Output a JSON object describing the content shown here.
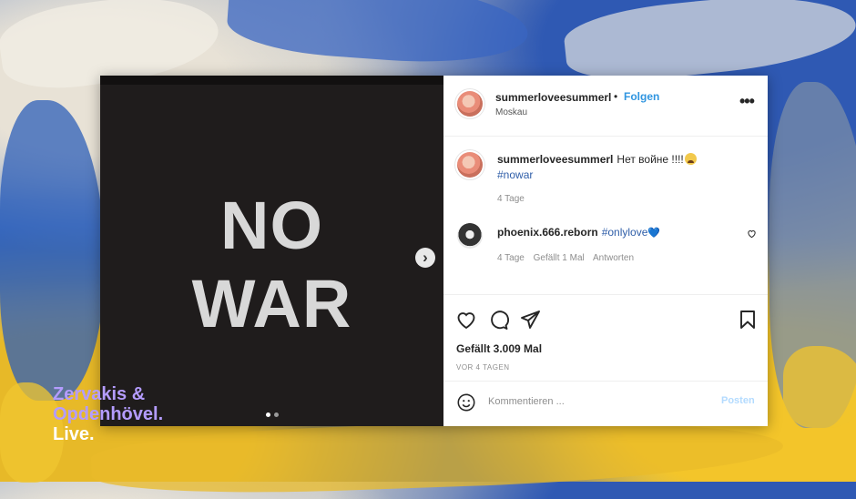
{
  "image": {
    "text_line_1": "NO",
    "text_line_2": "WAR",
    "carousel_dots": 2,
    "active_dot": 0
  },
  "post": {
    "username": "summerloveesummerl",
    "separator": "•",
    "follow_label": "Folgen",
    "location": "Moskau",
    "caption_text": "Нет войне !!!!",
    "hashtag": "#nowar",
    "caption_time": "4 Tage"
  },
  "comment": {
    "username": "phoenix.666.reborn",
    "text": "#onlylove",
    "heart_emoji": "💙",
    "time": "4 Tage",
    "likes": "Gefällt 1 Mal",
    "reply_label": "Antworten"
  },
  "actions": {
    "likes_text": "Gefällt 3.009 Mal",
    "ago_text": "VOR 4 TAGEN",
    "comment_placeholder": "Kommentieren ...",
    "post_label": "Posten"
  },
  "logo": {
    "line1": "Zervakis &",
    "line2": "Opdenhövel.",
    "line3": "Live."
  },
  "colors": {
    "link_blue": "#2f95e0",
    "hashtag_blue": "#2f5ea8",
    "logo_purple": "#b49cff",
    "media_bg": "#1f1c1c"
  },
  "icons": [
    "more-icon",
    "next-arrow-icon",
    "heart-icon",
    "comment-icon",
    "share-icon",
    "bookmark-icon",
    "smiley-icon"
  ]
}
